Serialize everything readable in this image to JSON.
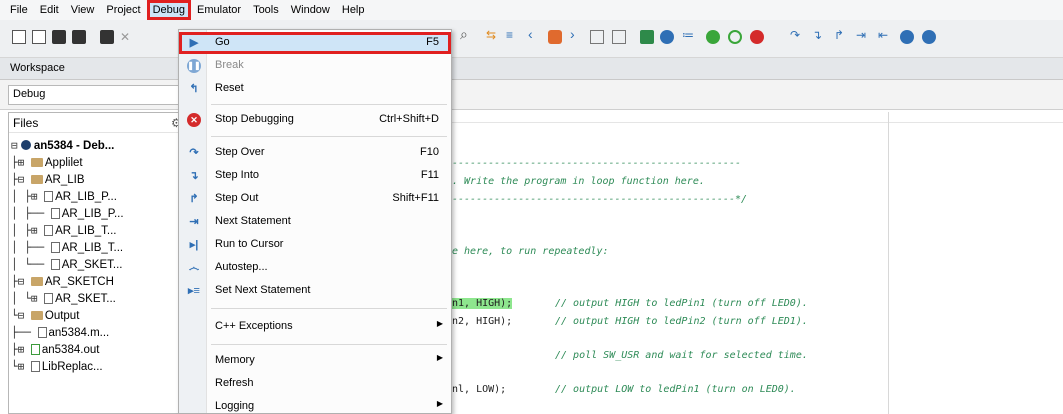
{
  "menubar": {
    "items": [
      "File",
      "Edit",
      "View",
      "Project",
      "Debug",
      "Emulator",
      "Tools",
      "Window",
      "Help"
    ],
    "active": "Debug"
  },
  "workspace": {
    "title": "Workspace"
  },
  "debug_combo": {
    "value": "Debug"
  },
  "files": {
    "header": "Files",
    "tree": [
      "an5384 - Deb...",
      "Applilet",
      "AR_LIB",
      "AR_LIB_P...",
      "AR_LIB_P...",
      "AR_LIB_T...",
      "AR_LIB_T...",
      "AR_SKET...",
      "AR_SKETCH",
      "AR_SKET...",
      "Output",
      "an5384.m...",
      "an5384.out",
      "LibReplac..."
    ]
  },
  "editor": {
    "lines": [
      "------------------------------------------------",
      ". Write the program in loop function here.",
      "-----------------------------------------------*/",
      "e here, to run repeatedly:",
      "n1, HIGH);",
      "n2, HIGH);",
      "nl, LOW);"
    ],
    "comments": [
      "// output HIGH to ledPin1 (turn off LED0).",
      "// output HIGH to ledPin2 (turn off LED1).",
      "// poll SW_USR and wait for selected time.",
      "// output LOW to ledPin1 (turn on LED0)."
    ]
  },
  "debug_menu": {
    "items": [
      {
        "label": "Go",
        "shortcut": "F5",
        "icon": "play-icon"
      },
      {
        "label": "Break",
        "shortcut": "",
        "icon": "pause-icon"
      },
      {
        "label": "Reset",
        "shortcut": "",
        "icon": "reset-icon"
      },
      {
        "label": "Stop Debugging",
        "shortcut": "Ctrl+Shift+D",
        "icon": "stop-icon"
      },
      {
        "label": "Step Over",
        "shortcut": "F10",
        "icon": "step-over-icon"
      },
      {
        "label": "Step Into",
        "shortcut": "F11",
        "icon": "step-into-icon"
      },
      {
        "label": "Step Out",
        "shortcut": "Shift+F11",
        "icon": "step-out-icon"
      },
      {
        "label": "Next Statement",
        "shortcut": "",
        "icon": "next-statement-icon"
      },
      {
        "label": "Run to Cursor",
        "shortcut": "",
        "icon": "run-to-cursor-icon"
      },
      {
        "label": "Autostep...",
        "shortcut": "",
        "icon": "autostep-icon"
      },
      {
        "label": "Set Next Statement",
        "shortcut": "",
        "icon": "set-next-statement-icon"
      },
      {
        "label": "C++ Exceptions",
        "shortcut": "",
        "icon": ""
      },
      {
        "label": "Memory",
        "shortcut": "",
        "icon": ""
      },
      {
        "label": "Refresh",
        "shortcut": "",
        "icon": ""
      },
      {
        "label": "Logging",
        "shortcut": "",
        "icon": ""
      }
    ]
  },
  "colors": {
    "highlight_outline": "#e02020",
    "selection_bg": "#cfe5f7",
    "comment_green": "#2e8b57",
    "code_highlight": "#8ee68e"
  }
}
